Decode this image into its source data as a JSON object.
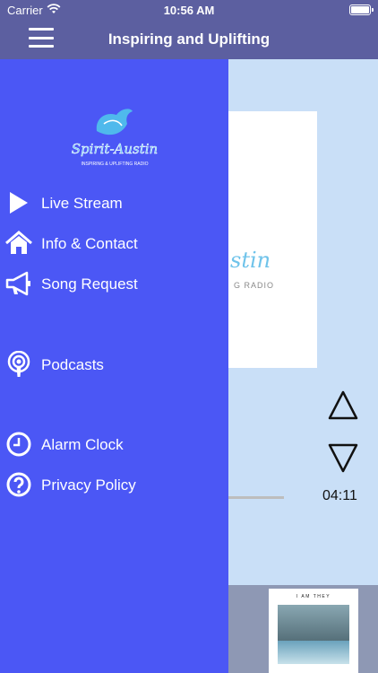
{
  "status_bar": {
    "carrier": "Carrier",
    "time": "10:56 AM"
  },
  "nav_bar": {
    "title": "Inspiring and Uplifting"
  },
  "drawer": {
    "logo_text": "Spirit-Austin",
    "logo_tagline": "INSPIRING & UPLIFTING RADIO",
    "items": [
      {
        "label": "Live Stream",
        "icon": "play-icon"
      },
      {
        "label": "Info & Contact",
        "icon": "home-icon"
      },
      {
        "label": "Song Request",
        "icon": "megaphone-icon"
      },
      {
        "label": "Podcasts",
        "icon": "podcast-icon"
      },
      {
        "label": "Alarm Clock",
        "icon": "clock-icon"
      },
      {
        "label": "Privacy Policy",
        "icon": "question-icon"
      }
    ]
  },
  "player": {
    "art_brand": "stin",
    "art_subtitle": "G RADIO",
    "timer": "04:11",
    "album_title": "I AM THEY"
  },
  "colors": {
    "drawer": "#4b57f5",
    "nav": "#5c5fa0",
    "background": "#c9dff7"
  }
}
